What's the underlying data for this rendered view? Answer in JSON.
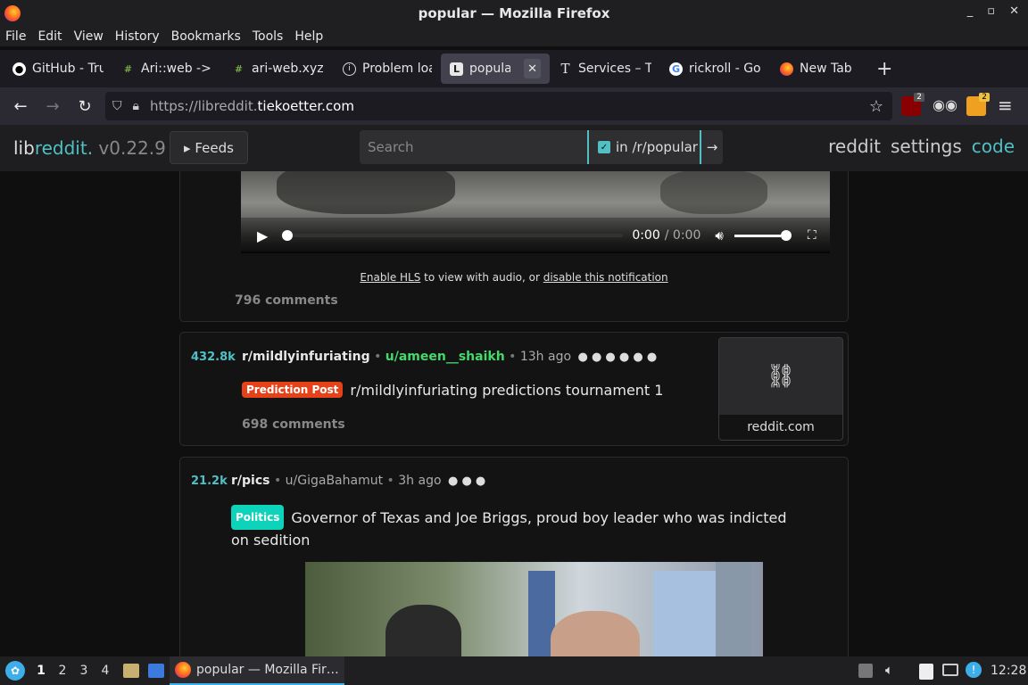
{
  "window": {
    "title": "popular — Mozilla Firefox"
  },
  "menu": [
    "File",
    "Edit",
    "View",
    "History",
    "Bookmarks",
    "Tools",
    "Help"
  ],
  "tabs": [
    {
      "label": "GitHub - Tru",
      "icon": "github-icon"
    },
    {
      "label": "Ari::web ->",
      "icon": "hash-icon"
    },
    {
      "label": "ari-web.xyz",
      "icon": "hash-icon"
    },
    {
      "label": "Problem loa",
      "icon": "info-icon"
    },
    {
      "label": "popular",
      "icon": "libreddit-icon",
      "active": true
    },
    {
      "label": "Services – T",
      "icon": "text-icon"
    },
    {
      "label": "rickroll - Go",
      "icon": "google-icon"
    },
    {
      "label": "New Tab",
      "icon": "firefox-icon"
    }
  ],
  "url": {
    "prefix": "https://libreddit.",
    "host": "tiekoetter.com"
  },
  "extensions": {
    "ublock_count": "2",
    "ext3_count": "2"
  },
  "libreddit": {
    "brand_lib": "lib",
    "brand_reddit": "reddit.",
    "version": " v0.22.9",
    "feeds_label": "▸ Feeds",
    "search_placeholder": "Search",
    "restrict_label": "in /r/popular",
    "links": [
      "reddit",
      "settings",
      "code"
    ]
  },
  "video": {
    "time": "0:00",
    "duration": "/ 0:00"
  },
  "notice": {
    "link1": "Enable HLS",
    "mid": " to view with audio, or ",
    "link2": "disable this notification"
  },
  "posts": [
    {
      "comments": "796 comments"
    },
    {
      "score": "432.8k",
      "subreddit": "r/mildlyinfuriating",
      "author": "u/ameen__shaikh",
      "age": "13h ago",
      "flair": "Prediction Post",
      "flair_color": "#e5421a",
      "title": "r/mildlyinfuriating predictions tournament 1",
      "comments": "698 comments",
      "thumb_label": "reddit.com"
    },
    {
      "score": "21.2k",
      "subreddit": "r/pics",
      "author": "u/GigaBahamut",
      "age": "3h ago",
      "flair": "Politics",
      "flair_color": "#0dd3bb",
      "title": "Governor of Texas and Joe Briggs, proud boy leader who was indicted on sedition"
    }
  ],
  "taskbar": {
    "workspaces": [
      "1",
      "2",
      "3",
      "4"
    ],
    "active_task": "popular — Mozilla Fir…",
    "clock": "12:28"
  },
  "colors": {
    "accent": "#50c0c4",
    "author_green": "#45d96b"
  }
}
